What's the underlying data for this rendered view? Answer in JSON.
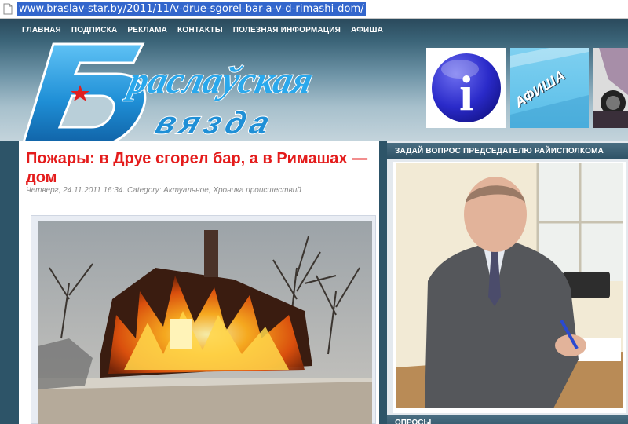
{
  "browser": {
    "url": "www.braslav-star.by/2011/11/v-drue-sgorel-bar-a-v-d-rimashi-dom/"
  },
  "nav": {
    "items": [
      "ГЛАВНАЯ",
      "ПОДПИСКА",
      "РЕКЛАМА",
      "КОНТАКТЫ",
      "ПОЛЕЗНАЯ ИНФОРМАЦИЯ",
      "АФИША"
    ]
  },
  "logo": {
    "line1": "раслаўская",
    "line2": "вязда"
  },
  "banners": {
    "info_symbol": "i",
    "afisha": "АФИША"
  },
  "article": {
    "title": "Пожары: в Друе сгорел бар, а в Римашах — дом",
    "meta": "Четверг, 24.11.2011 16:34. Category: Актуальное, Хроника происшествий"
  },
  "sidebar": {
    "ask_title": "ЗАДАЙ ВОПРОС ПРЕДСЕДАТЕЛЮ РАЙИСПОЛКОМА",
    "polls_title": "ОПРОСЫ"
  },
  "colors": {
    "accent_red": "#e41c1c",
    "header_dark": "#2d5468",
    "logo_blue": "#1f8fd6"
  }
}
